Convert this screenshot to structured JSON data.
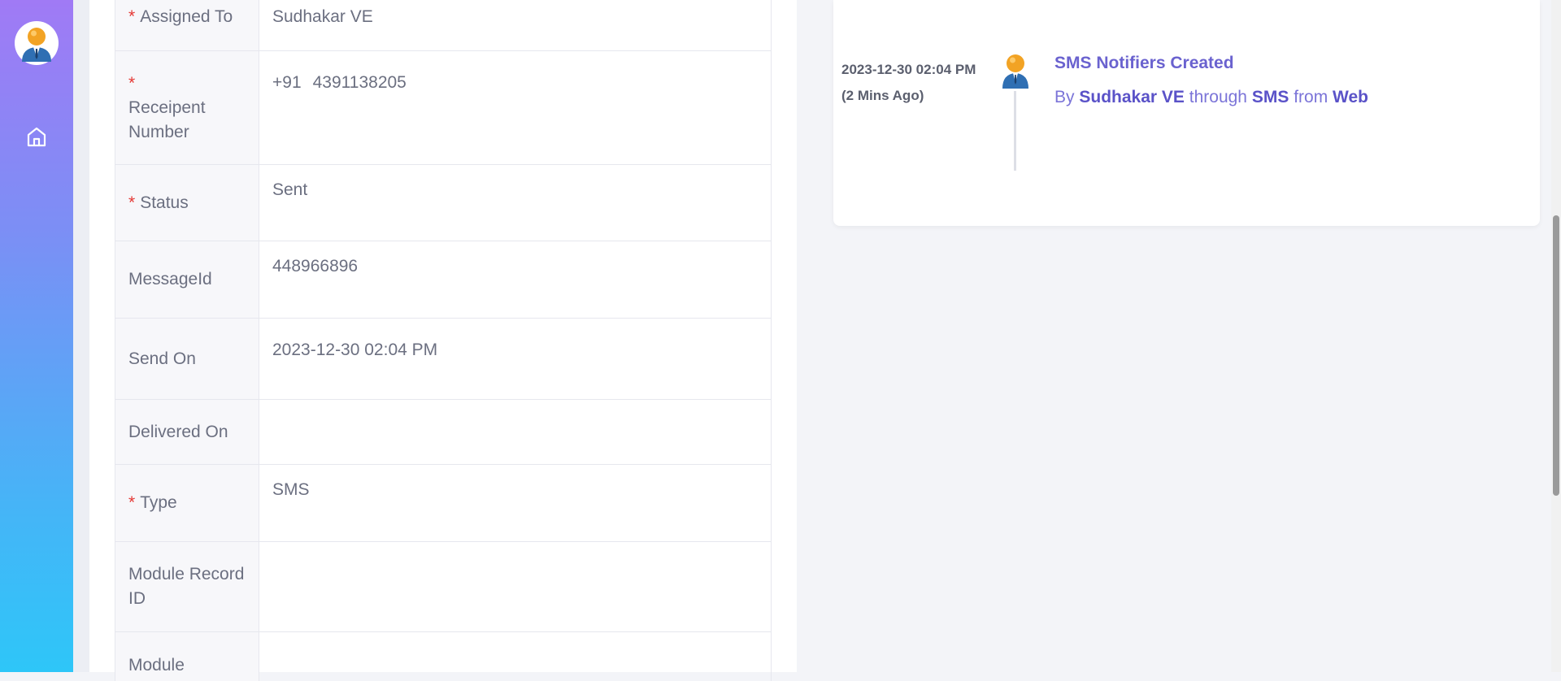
{
  "sidebar": {
    "avatar_icon": "user-avatar-icon",
    "home_icon": "home-icon"
  },
  "fields": {
    "assigned_to": {
      "label": "Assigned To",
      "required": "*",
      "value": "Sudhakar VE"
    },
    "receipent_number": {
      "label_line1": "Receipent",
      "label_line2": "Number",
      "required": "*",
      "country_code": "+91",
      "number": "4391138205"
    },
    "status": {
      "label": "Status",
      "required": "*",
      "value": "Sent"
    },
    "message_id": {
      "label": "MessageId",
      "value": "448966896"
    },
    "send_on": {
      "label": "Send On",
      "value": "2023-12-30 02:04 PM"
    },
    "delivered_on": {
      "label": "Delivered On",
      "value": ""
    },
    "type": {
      "label": "Type",
      "required": "*",
      "value": "SMS"
    },
    "module_record_id": {
      "label_line1": "Module Record",
      "label_line2": "ID",
      "value": ""
    },
    "module": {
      "label": "Module",
      "value": ""
    }
  },
  "timeline": {
    "time": "2023-12-30 02:04 PM",
    "ago": "(2 Mins Ago)",
    "title": "SMS Notifiers Created",
    "by_label": "By",
    "user": "Sudhakar VE",
    "through_label": "through",
    "channel": "SMS",
    "from_label": "from",
    "source": "Web"
  },
  "colors": {
    "accent": "#6a62cf",
    "required": "#e53935",
    "sidebar_top": "#a07af5",
    "sidebar_bottom": "#2ec6f8"
  }
}
